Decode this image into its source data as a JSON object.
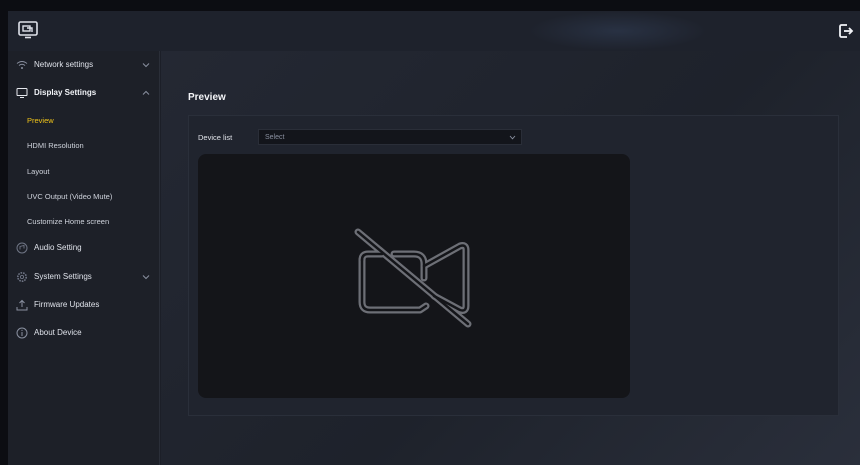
{
  "header": {
    "logo_icon": "screen-share-icon",
    "logout_icon": "logout-icon"
  },
  "sidebar": {
    "items": [
      {
        "label": "Network settings",
        "icon": "wifi-icon",
        "expandable": true
      },
      {
        "label": "Display Settings",
        "icon": "monitor-icon",
        "expandable": true,
        "expanded": true
      },
      {
        "label": "Audio Setting",
        "icon": "audio-icon",
        "expandable": false
      },
      {
        "label": "System Settings",
        "icon": "gear-icon",
        "expandable": true
      },
      {
        "label": "Firmware Updates",
        "icon": "upload-icon",
        "expandable": false
      },
      {
        "label": "About Device",
        "icon": "info-icon",
        "expandable": false
      }
    ],
    "display_sub_items": [
      {
        "label": "Preview",
        "active": true
      },
      {
        "label": "HDMI Resolution"
      },
      {
        "label": "Layout"
      },
      {
        "label": "UVC Output (Video Mute)"
      },
      {
        "label": "Customize Home screen"
      }
    ]
  },
  "main": {
    "title": "Preview",
    "device_list_label": "Device list",
    "device_select_value": "Select",
    "preview_icon": "video-off-icon"
  },
  "colors": {
    "accent": "#f0c419",
    "sidebar_bg": "#1d2028",
    "preview_bg": "#141519"
  }
}
